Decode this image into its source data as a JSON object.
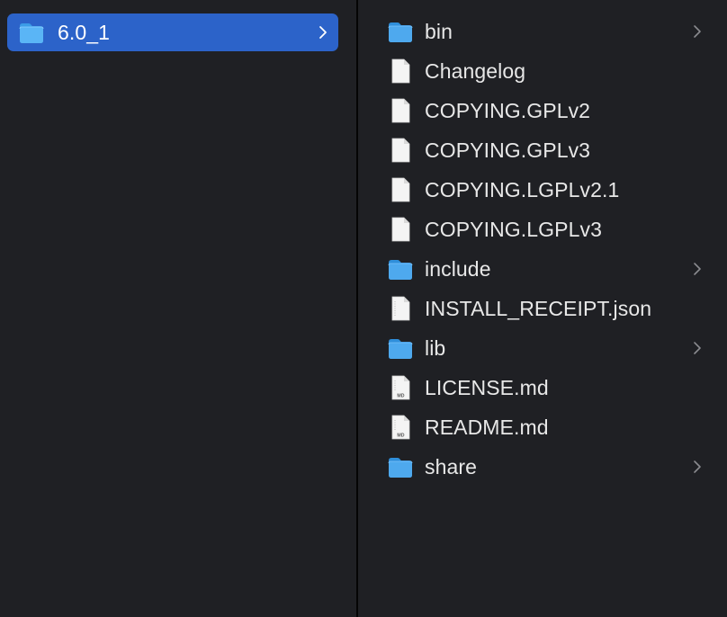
{
  "window": {
    "type": "finder-column-view"
  },
  "left_column": {
    "selected": {
      "label": "6.0_1",
      "icon": "folder-icon"
    }
  },
  "right_column": {
    "items": [
      {
        "label": "bin",
        "kind": "folder",
        "icon": "folder-icon",
        "has_children": true
      },
      {
        "label": "Changelog",
        "kind": "file",
        "icon": "document-icon",
        "has_children": false
      },
      {
        "label": "COPYING.GPLv2",
        "kind": "file",
        "icon": "document-icon",
        "has_children": false
      },
      {
        "label": "COPYING.GPLv3",
        "kind": "file",
        "icon": "document-icon",
        "has_children": false
      },
      {
        "label": "COPYING.LGPLv2.1",
        "kind": "file",
        "icon": "document-icon",
        "has_children": false
      },
      {
        "label": "COPYING.LGPLv3",
        "kind": "file",
        "icon": "document-icon",
        "has_children": false
      },
      {
        "label": "include",
        "kind": "folder",
        "icon": "folder-icon",
        "has_children": true
      },
      {
        "label": "INSTALL_RECEIPT.json",
        "kind": "file",
        "icon": "json-file-icon",
        "has_children": false
      },
      {
        "label": "lib",
        "kind": "folder",
        "icon": "folder-icon",
        "has_children": true
      },
      {
        "label": "LICENSE.md",
        "kind": "file",
        "icon": "markdown-file-icon",
        "has_children": false,
        "badge": "MD"
      },
      {
        "label": "README.md",
        "kind": "file",
        "icon": "markdown-file-icon",
        "has_children": false,
        "badge": "MD"
      },
      {
        "label": "share",
        "kind": "folder",
        "icon": "folder-icon",
        "has_children": true
      }
    ]
  },
  "colors": {
    "background": "#1f2024",
    "selection": "#2c63c9",
    "text": "#e8e8e8",
    "folder": "#48a7f0",
    "chevron": "#8a8a8f"
  }
}
